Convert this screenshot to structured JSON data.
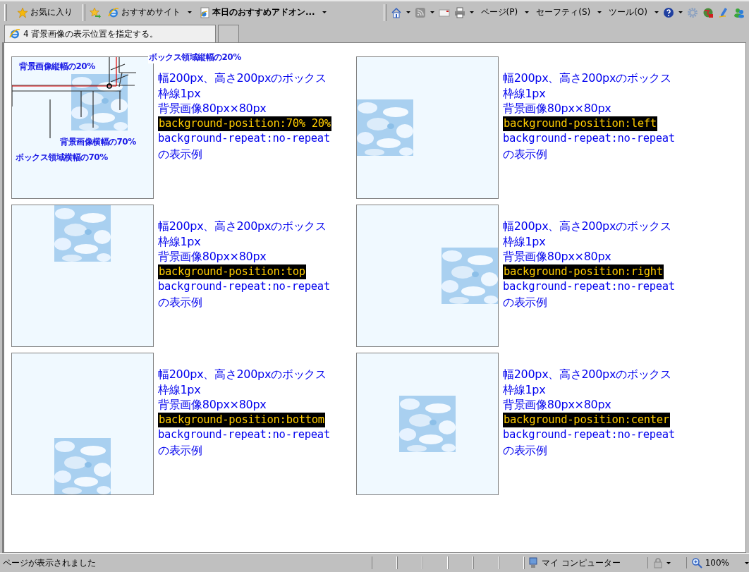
{
  "toolbar": {
    "favorites": "お気に入り",
    "links": [
      {
        "label": "おすすめサイト",
        "bold": false
      },
      {
        "label": "本日のおすすめアドオン...",
        "bold": true
      }
    ],
    "menus": [
      "ページ(P)",
      "セーフティ(S)",
      "ツール(O)"
    ]
  },
  "tabs": [
    {
      "label": "4 背景画像の表示位置を指定する。",
      "selected": true
    },
    {
      "selected": false
    }
  ],
  "examples": [
    {
      "kind": "percent",
      "annotations": [
        {
          "kind": "box-v",
          "text": "ボックス領域縦幅の20%"
        },
        {
          "kind": "img-v",
          "text": "背景画像縦幅の20%"
        },
        {
          "kind": "img-h",
          "text": "背景画像横幅の70%"
        },
        {
          "kind": "box-h",
          "text": "ボックス領域横幅の70%"
        }
      ],
      "lines": [
        {
          "text": "幅200px、高さ200pxのボックス",
          "highlighted": false
        },
        {
          "text": "枠線1px",
          "highlighted": false
        },
        {
          "text": "背景画像80px×80px",
          "highlighted": false
        },
        {
          "text": "background-position:70% 20%",
          "highlighted": true
        },
        {
          "text": "background-repeat:no-repeat",
          "highlighted": false
        },
        {
          "text": "の表示例",
          "highlighted": false
        }
      ]
    },
    {
      "kind": "left",
      "lines": [
        {
          "text": "幅200px、高さ200pxのボックス",
          "highlighted": false
        },
        {
          "text": "枠線1px",
          "highlighted": false
        },
        {
          "text": "背景画像80px×80px",
          "highlighted": false
        },
        {
          "text": "background-position:left",
          "highlighted": true
        },
        {
          "text": "background-repeat:no-repeat",
          "highlighted": false
        },
        {
          "text": "の表示例",
          "highlighted": false
        }
      ]
    },
    {
      "kind": "top",
      "lines": [
        {
          "text": "幅200px、高さ200pxのボックス",
          "highlighted": false
        },
        {
          "text": "枠線1px",
          "highlighted": false
        },
        {
          "text": "背景画像80px×80px",
          "highlighted": false
        },
        {
          "text": "background-position:top",
          "highlighted": true
        },
        {
          "text": "background-repeat:no-repeat",
          "highlighted": false
        },
        {
          "text": "の表示例",
          "highlighted": false
        }
      ]
    },
    {
      "kind": "right",
      "lines": [
        {
          "text": "幅200px、高さ200pxのボックス",
          "highlighted": false
        },
        {
          "text": "枠線1px",
          "highlighted": false
        },
        {
          "text": "背景画像80px×80px",
          "highlighted": false
        },
        {
          "text": "background-position:right",
          "highlighted": true
        },
        {
          "text": "background-repeat:no-repeat",
          "highlighted": false
        },
        {
          "text": "の表示例",
          "highlighted": false
        }
      ]
    },
    {
      "kind": "bottom",
      "lines": [
        {
          "text": "幅200px、高さ200pxのボックス",
          "highlighted": false
        },
        {
          "text": "枠線1px",
          "highlighted": false
        },
        {
          "text": "背景画像80px×80px",
          "highlighted": false
        },
        {
          "text": "background-position:bottom",
          "highlighted": true
        },
        {
          "text": "background-repeat:no-repeat",
          "highlighted": false
        },
        {
          "text": "の表示例",
          "highlighted": false
        }
      ]
    },
    {
      "kind": "center",
      "lines": [
        {
          "text": "幅200px、高さ200pxのボックス",
          "highlighted": false
        },
        {
          "text": "枠線1px",
          "highlighted": false
        },
        {
          "text": "背景画像80px×80px",
          "highlighted": false
        },
        {
          "text": "background-position:center",
          "highlighted": true
        },
        {
          "text": "background-repeat:no-repeat",
          "highlighted": false
        },
        {
          "text": "の表示例",
          "highlighted": false
        }
      ]
    }
  ],
  "status_bar": {
    "message": "ページが表示されました",
    "zone": "マイ コンピューター",
    "zoom": "100%"
  }
}
